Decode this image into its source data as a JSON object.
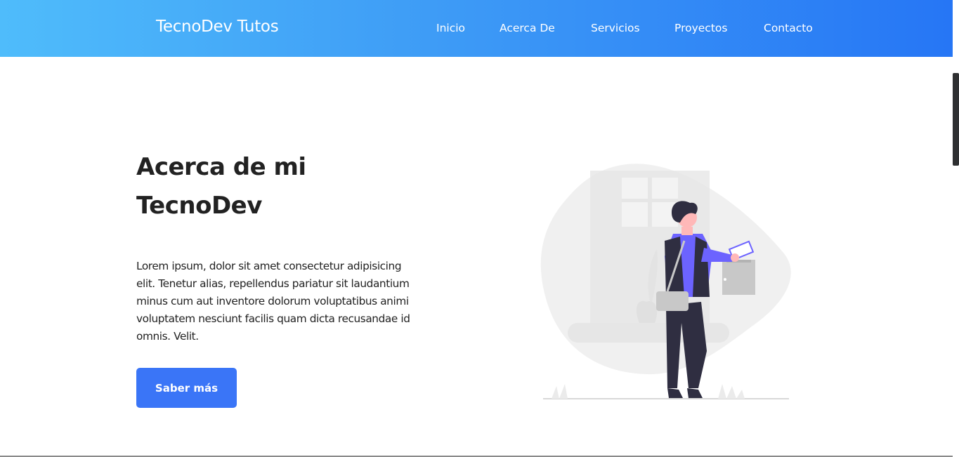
{
  "header": {
    "brand": "TecnoDev Tutos",
    "nav": [
      "Inicio",
      "Acerca De",
      "Servicios",
      "Proyectos",
      "Contacto"
    ]
  },
  "hero": {
    "title_line1": "Acerca de mi",
    "title_line2": "TecnoDev",
    "paragraph": "Lorem ipsum, dolor sit amet consectetur adipisicing elit. Tenetur alias, repellendus pariatur sit laudantium minus cum aut inventore dolorum voluptatibus animi voluptatem nesciunt facilis quam dicta recusandae id omnis. Velit.",
    "cta_label": "Saber más"
  },
  "colors": {
    "nav_gradient_start": "#4fbcfb",
    "nav_gradient_end": "#2676f5",
    "button": "#3a75f7",
    "illustration_accent": "#6c63ff",
    "text": "#222222"
  },
  "illustration": {
    "icon": "person-mailbox-illustration"
  }
}
